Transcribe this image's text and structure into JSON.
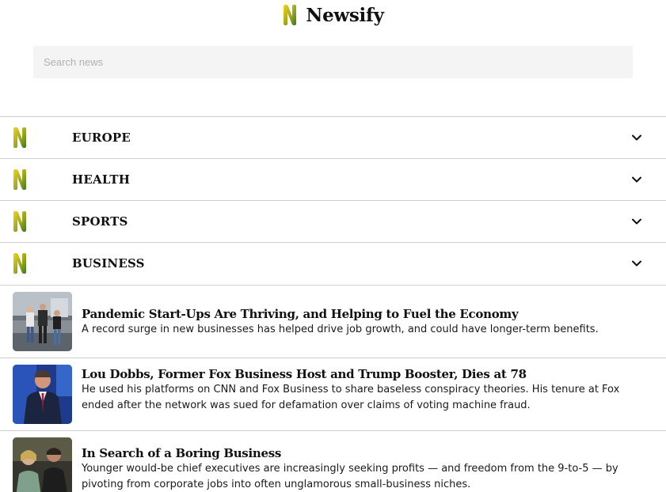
{
  "brand": {
    "name": "Newsify",
    "logo_icon": "newsify-n-logo-icon"
  },
  "search": {
    "placeholder": "Search news",
    "value": ""
  },
  "categories": [
    {
      "label": "EUROPE",
      "icon": "chevron-down-icon"
    },
    {
      "label": "HEALTH",
      "icon": "chevron-down-icon"
    },
    {
      "label": "SPORTS",
      "icon": "chevron-down-icon"
    },
    {
      "label": "BUSINESS",
      "icon": "chevron-down-icon"
    }
  ],
  "articles": [
    {
      "headline": "Pandemic Start-Ups Are Thriving, and Helping to Fuel the Economy",
      "summary": "A record surge in new businesses has helped drive job growth, and could have longer-term benefits."
    },
    {
      "headline": "Lou Dobbs, Former Fox Business Host and Trump Booster, Dies at 78",
      "summary": "He used his platforms on CNN and Fox Business to share baseless conspiracy theories. His tenure at Fox ended after the network was sued for defamation over claims of voting machine fraud."
    },
    {
      "headline": "In Search of a Boring Business",
      "summary": "Younger would-be chief executives are increasingly seeking profits — and freedom from the 9-to-5 — by pivoting from corporate jobs into often unglamorous small-business niches."
    }
  ],
  "colors": {
    "logo_yellow": "#e3c012",
    "logo_green": "#4a7d1c",
    "divider": "#cfcfcf",
    "search_bg": "#f4f4f4"
  }
}
